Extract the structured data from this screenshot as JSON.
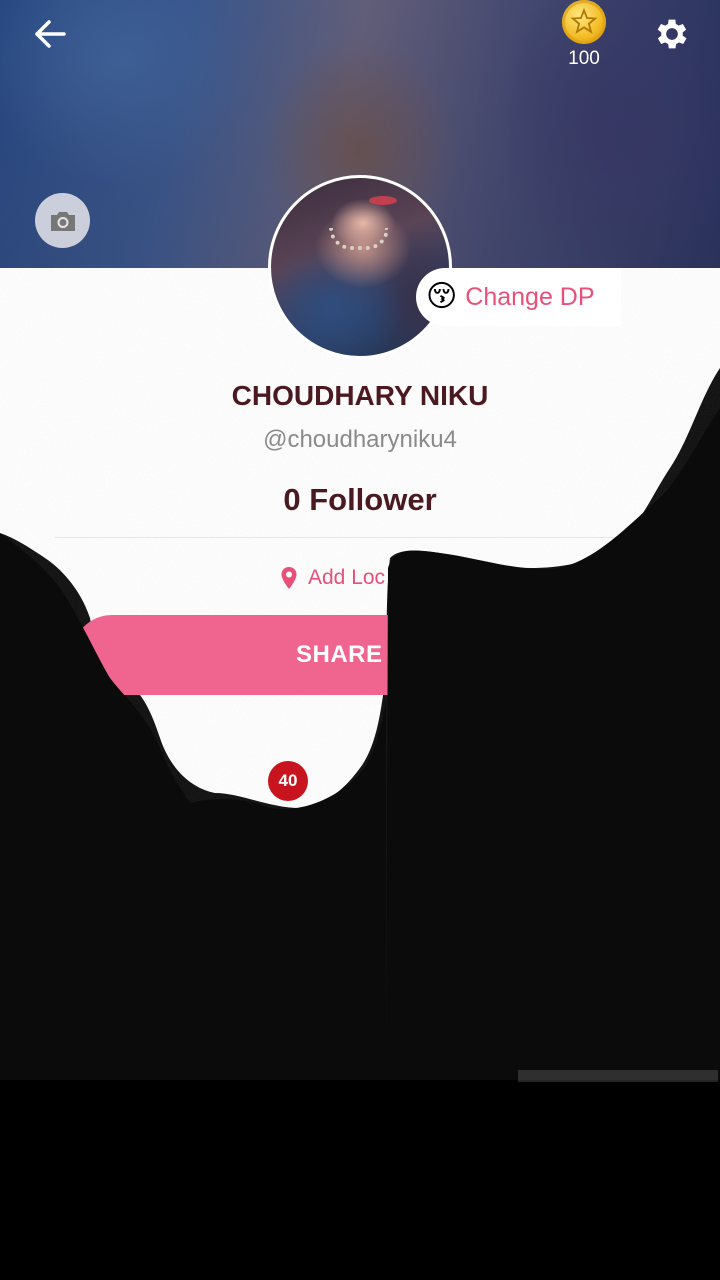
{
  "header": {
    "back_icon": "arrow-left-icon",
    "coin_icon": "gold-coin-star-icon",
    "coin_count": "100",
    "settings_icon": "gear-icon",
    "camera_icon": "camera-icon"
  },
  "profile": {
    "change_dp_emoji": "😚",
    "change_dp_label": "Change DP",
    "name": "CHOUDHARY NIKU",
    "handle": "@choudharyniku4",
    "followers": "0 Follower",
    "location_icon": "map-pin-icon",
    "location_label": "Add Loc",
    "share_label": "SHARE PR",
    "badge_count": "40"
  },
  "colors": {
    "accent": "#f06490",
    "text_accent": "#e8507a",
    "name_text": "#4a1a20",
    "badge": "#c8141e"
  }
}
